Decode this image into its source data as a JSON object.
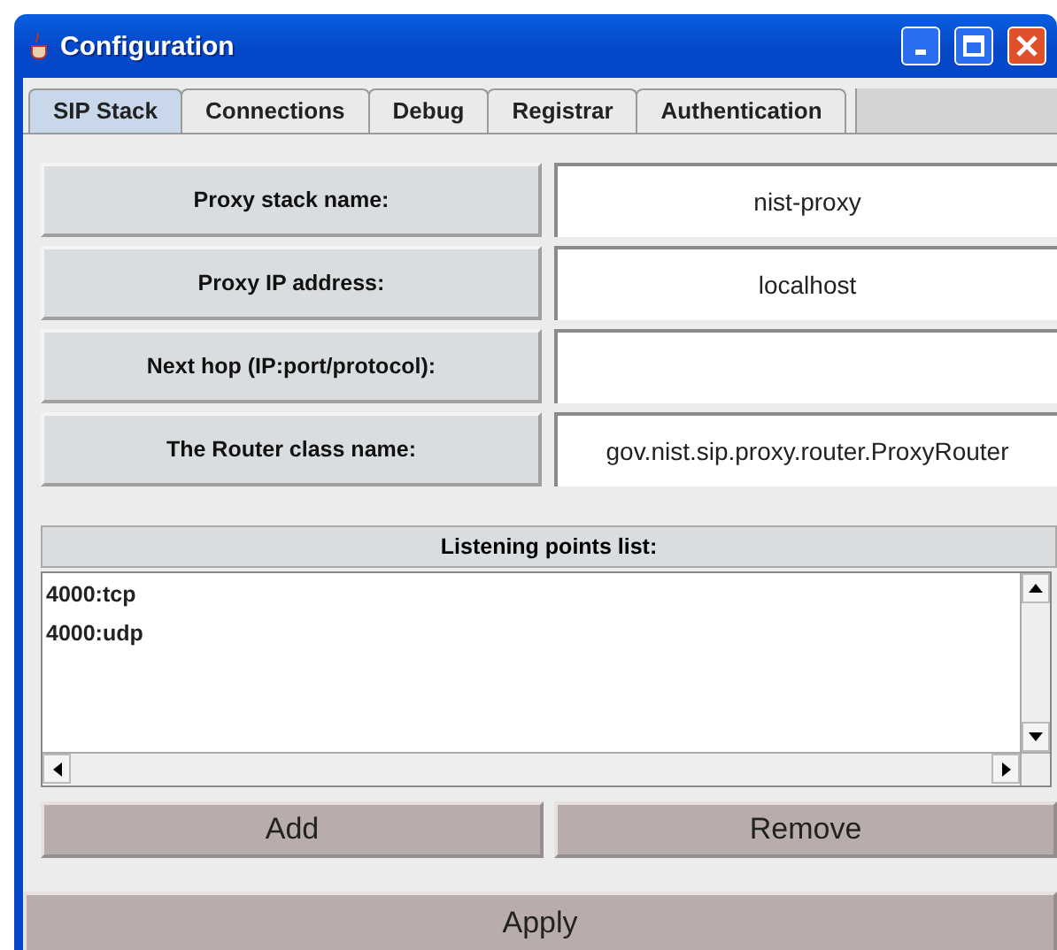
{
  "window": {
    "title": "Configuration"
  },
  "tabs": [
    {
      "label": "SIP Stack",
      "selected": true
    },
    {
      "label": "Connections",
      "selected": false
    },
    {
      "label": "Debug",
      "selected": false
    },
    {
      "label": "Registrar",
      "selected": false
    },
    {
      "label": "Authentication",
      "selected": false
    }
  ],
  "fields": [
    {
      "label": "Proxy stack name:",
      "value": "nist-proxy"
    },
    {
      "label": "Proxy IP address:",
      "value": "localhost"
    },
    {
      "label": "Next hop (IP:port/protocol):"
    },
    {
      "label": "The Router class name:",
      "value": "gov.nist.sip.proxy.router.ProxyRouter"
    }
  ],
  "listening_points": {
    "header": "Listening points list:",
    "items": [
      "4000:tcp",
      "4000:udp"
    ]
  },
  "buttons": [
    "Add",
    "Remove"
  ],
  "apply_button": "Apply"
}
